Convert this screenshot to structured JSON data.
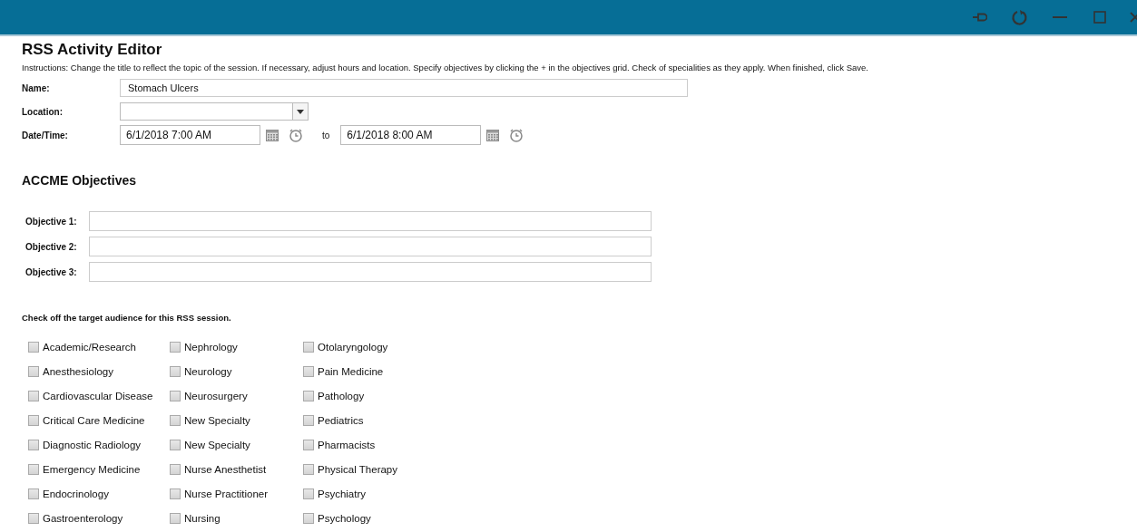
{
  "title": "RSS Activity Editor",
  "instructions": "Instructions: Change the title to reflect the topic of the session. If necessary, adjust hours and location. Specify objectives by clicking the + in the objectives grid. Check of specialities as they apply. When finished, click Save.",
  "name": {
    "label": "Name:",
    "value": "Stomach Ulcers"
  },
  "location": {
    "label": "Location:"
  },
  "datetime": {
    "label": "Date/Time:",
    "start": "6/1/2018 7:00 AM",
    "separator": "to",
    "end": "6/1/2018 8:00 AM"
  },
  "objectives_title": "ACCME Objectives",
  "objectives": [
    {
      "label": "Objective 1:"
    },
    {
      "label": "Objective 2:"
    },
    {
      "label": "Objective 3:"
    }
  ],
  "audience_title": "Check off the target audience for this RSS session.",
  "audience_columns": [
    [
      {
        "label": "Academic/Research",
        "checked": false
      },
      {
        "label": "Anesthesiology",
        "checked": false
      },
      {
        "label": "Cardiovascular Disease",
        "checked": false
      },
      {
        "label": "Critical Care Medicine",
        "checked": false
      },
      {
        "label": "Diagnostic Radiology",
        "checked": false
      },
      {
        "label": "Emergency Medicine",
        "checked": false
      },
      {
        "label": "Endocrinology",
        "checked": false
      },
      {
        "label": "Gastroenterology",
        "checked": false
      }
    ],
    [
      {
        "label": "Nephrology",
        "checked": false
      },
      {
        "label": "Neurology",
        "checked": false
      },
      {
        "label": "Neurosurgery",
        "checked": false
      },
      {
        "label": "New Specialty",
        "checked": false
      },
      {
        "label": "New Specialty",
        "checked": false
      },
      {
        "label": "Nurse Anesthetist",
        "checked": false
      },
      {
        "label": "Nurse Practitioner",
        "checked": false
      },
      {
        "label": "Nursing",
        "checked": false
      }
    ],
    [
      {
        "label": "Otolaryngology",
        "checked": false
      },
      {
        "label": "Pain Medicine",
        "checked": false
      },
      {
        "label": "Pathology",
        "checked": false
      },
      {
        "label": "Pediatrics",
        "checked": false
      },
      {
        "label": "Pharmacists",
        "checked": false
      },
      {
        "label": "Physical Therapy",
        "checked": false
      },
      {
        "label": "Psychiatry",
        "checked": false
      },
      {
        "label": "Psychology",
        "checked": false
      }
    ]
  ]
}
